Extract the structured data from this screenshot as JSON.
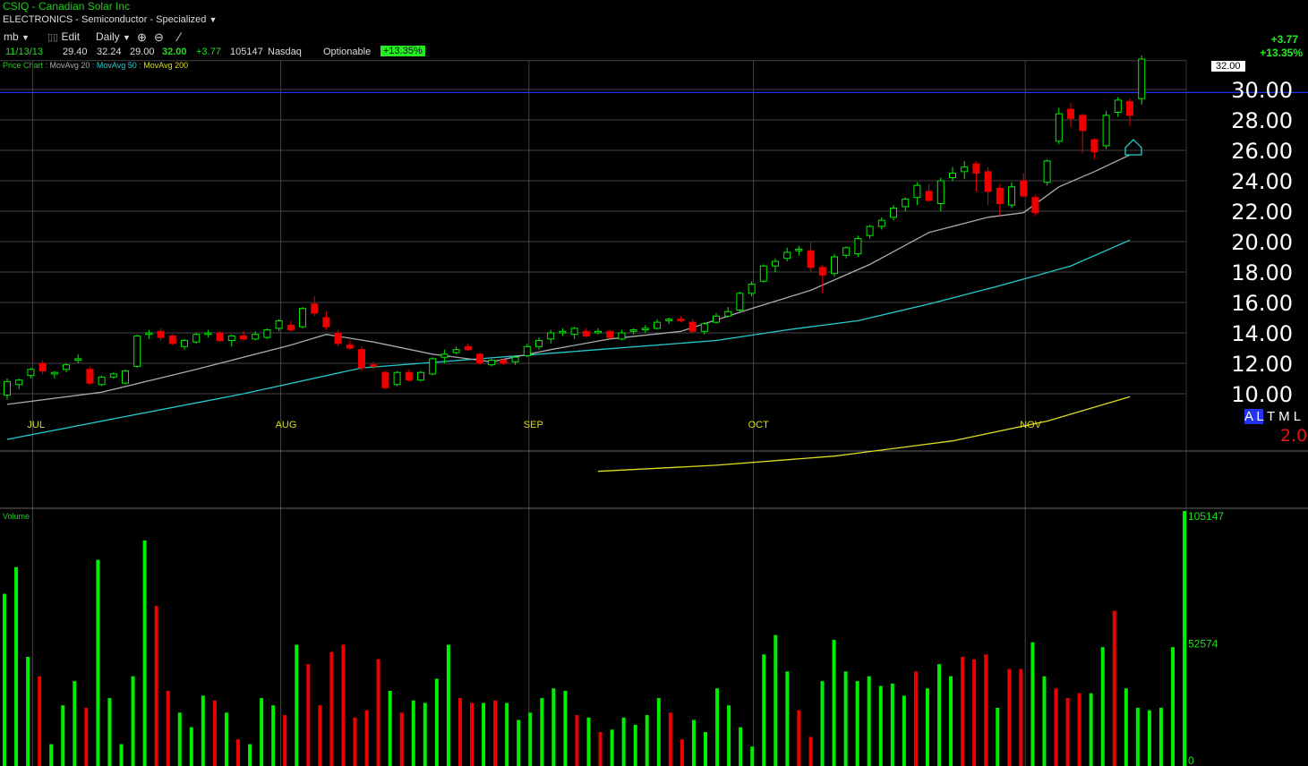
{
  "header": {
    "symbol_title": "CSIQ - Canadian Solar Inc",
    "sector": "ELECTRONICS - Semiconductor - Specialized",
    "toolbar": {
      "list_label": "mb",
      "edit_label": "Edit",
      "period_label": "Daily"
    },
    "quote": {
      "date": "11/13/13",
      "open": "29.40",
      "high": "32.24",
      "low": "29.00",
      "close": "32.00",
      "change": "+3.77",
      "volume": "105147",
      "exchange": "Nasdaq",
      "optionable": "Optionable",
      "pct_change": "+13.35%"
    },
    "right_change": "+3.77",
    "right_pct": "+13.35%"
  },
  "legend": {
    "price_chart": "Price Chart",
    "ma20": "MovAvg 20",
    "ma50": "MovAvg 50",
    "ma200": "MovAvg 200"
  },
  "badges": {
    "last_price": "32.00",
    "al": "A L",
    "tml": "T M L",
    "rating": "2.0"
  },
  "colors": {
    "up": "#00ee00",
    "down": "#ee0000",
    "ma20": "#aaaaaa",
    "ma50": "#22cccc",
    "ma200": "#dddd22",
    "grid": "#444444",
    "hline": "#2233ee"
  },
  "chart_data": [
    {
      "type": "candlestick",
      "title": "CSIQ - Canadian Solar Inc",
      "ylim": [
        9,
        32.5
      ],
      "yticks": [
        "10.00",
        "12.00",
        "14.00",
        "16.00",
        "18.00",
        "20.00",
        "22.00",
        "24.00",
        "26.00",
        "28.00",
        "30.00"
      ],
      "ytick_values": [
        10,
        12,
        14,
        16,
        18,
        20,
        22,
        24,
        26,
        28,
        30
      ],
      "month_labels": [
        {
          "label": "JUL",
          "index": 2
        },
        {
          "label": "AUG",
          "index": 23
        },
        {
          "label": "SEP",
          "index": 44
        },
        {
          "label": "OCT",
          "index": 63
        },
        {
          "label": "NOV",
          "index": 86
        }
      ],
      "horizontal_line": 29.8,
      "candles": [
        [
          9.9,
          11.0,
          9.6,
          10.8
        ],
        [
          10.6,
          11.0,
          10.3,
          10.9
        ],
        [
          11.2,
          11.7,
          11.0,
          11.6
        ],
        [
          12.0,
          12.2,
          11.3,
          11.5
        ],
        [
          11.3,
          11.5,
          11.0,
          11.4
        ],
        [
          11.6,
          12.0,
          11.4,
          11.9
        ],
        [
          12.2,
          12.6,
          12.0,
          12.3
        ],
        [
          11.6,
          11.8,
          10.6,
          10.7
        ],
        [
          10.6,
          11.2,
          10.5,
          11.1
        ],
        [
          11.1,
          11.4,
          11.0,
          11.3
        ],
        [
          10.7,
          11.6,
          10.6,
          11.5
        ],
        [
          11.8,
          13.9,
          11.7,
          13.8
        ],
        [
          13.9,
          14.2,
          13.6,
          14.0
        ],
        [
          14.1,
          14.3,
          13.5,
          13.7
        ],
        [
          13.8,
          13.9,
          13.2,
          13.3
        ],
        [
          13.1,
          13.6,
          12.9,
          13.5
        ],
        [
          13.4,
          14.0,
          13.3,
          13.9
        ],
        [
          13.9,
          14.2,
          13.7,
          14.0
        ],
        [
          14.0,
          14.1,
          13.4,
          13.5
        ],
        [
          13.5,
          13.9,
          13.1,
          13.8
        ],
        [
          13.8,
          14.1,
          13.5,
          13.6
        ],
        [
          13.6,
          14.1,
          13.5,
          13.9
        ],
        [
          13.7,
          14.3,
          13.6,
          14.2
        ],
        [
          14.3,
          14.9,
          14.1,
          14.8
        ],
        [
          14.5,
          14.8,
          14.1,
          14.2
        ],
        [
          14.4,
          15.7,
          14.3,
          15.6
        ],
        [
          15.9,
          16.4,
          15.1,
          15.3
        ],
        [
          15.0,
          15.4,
          14.2,
          14.4
        ],
        [
          14.0,
          14.2,
          13.1,
          13.3
        ],
        [
          13.2,
          13.5,
          12.9,
          13.0
        ],
        [
          12.9,
          13.1,
          11.5,
          11.7
        ],
        [
          11.9,
          12.1,
          11.6,
          11.8
        ],
        [
          11.4,
          11.5,
          10.3,
          10.4
        ],
        [
          10.6,
          11.5,
          10.5,
          11.4
        ],
        [
          11.4,
          11.6,
          10.8,
          10.9
        ],
        [
          10.9,
          11.5,
          10.8,
          11.4
        ],
        [
          11.3,
          12.4,
          11.2,
          12.3
        ],
        [
          12.4,
          12.9,
          12.0,
          12.6
        ],
        [
          12.7,
          13.1,
          12.6,
          12.9
        ],
        [
          13.1,
          13.3,
          12.8,
          12.9
        ],
        [
          12.6,
          12.7,
          11.9,
          12.0
        ],
        [
          11.9,
          12.3,
          11.8,
          12.2
        ],
        [
          12.2,
          12.3,
          11.9,
          12.0
        ],
        [
          12.1,
          12.5,
          11.9,
          12.4
        ],
        [
          12.5,
          13.3,
          12.4,
          13.1
        ],
        [
          13.1,
          13.7,
          12.9,
          13.5
        ],
        [
          13.6,
          14.2,
          13.3,
          14.0
        ],
        [
          14.0,
          14.3,
          13.8,
          14.1
        ],
        [
          13.9,
          14.4,
          13.6,
          14.3
        ],
        [
          14.1,
          14.3,
          13.7,
          13.8
        ],
        [
          14.0,
          14.3,
          13.9,
          14.1
        ],
        [
          14.1,
          14.2,
          13.6,
          13.7
        ],
        [
          13.6,
          14.2,
          13.5,
          14.0
        ],
        [
          14.1,
          14.3,
          13.9,
          14.2
        ],
        [
          14.2,
          14.5,
          14.0,
          14.3
        ],
        [
          14.3,
          14.9,
          14.2,
          14.7
        ],
        [
          14.8,
          15.0,
          14.6,
          14.9
        ],
        [
          14.9,
          15.1,
          14.7,
          14.8
        ],
        [
          14.7,
          14.9,
          14.0,
          14.1
        ],
        [
          14.1,
          14.7,
          13.9,
          14.6
        ],
        [
          14.7,
          15.3,
          14.6,
          15.1
        ],
        [
          15.1,
          15.7,
          15.0,
          15.4
        ],
        [
          15.5,
          16.7,
          15.4,
          16.6
        ],
        [
          16.6,
          17.4,
          16.4,
          17.2
        ],
        [
          17.4,
          18.5,
          17.3,
          18.4
        ],
        [
          18.4,
          18.9,
          18.0,
          18.7
        ],
        [
          18.9,
          19.6,
          18.7,
          19.3
        ],
        [
          19.4,
          19.7,
          19.1,
          19.5
        ],
        [
          19.4,
          20.0,
          18.0,
          18.3
        ],
        [
          18.3,
          18.5,
          16.6,
          17.8
        ],
        [
          17.9,
          19.2,
          17.7,
          19.0
        ],
        [
          19.1,
          19.7,
          18.9,
          19.6
        ],
        [
          19.2,
          20.4,
          19.0,
          20.2
        ],
        [
          20.4,
          21.1,
          20.2,
          21.0
        ],
        [
          21.0,
          21.6,
          20.8,
          21.4
        ],
        [
          21.6,
          22.4,
          21.4,
          22.2
        ],
        [
          22.3,
          22.9,
          22.0,
          22.8
        ],
        [
          22.9,
          23.9,
          22.4,
          23.7
        ],
        [
          23.3,
          23.8,
          23.1,
          22.7
        ],
        [
          22.5,
          24.2,
          22.0,
          24.0
        ],
        [
          24.2,
          24.9,
          24.0,
          24.5
        ],
        [
          24.6,
          25.3,
          24.1,
          24.9
        ],
        [
          25.1,
          25.3,
          23.3,
          24.5
        ],
        [
          24.6,
          24.9,
          22.4,
          23.3
        ],
        [
          23.5,
          23.8,
          21.7,
          22.5
        ],
        [
          22.4,
          23.9,
          22.2,
          23.6
        ],
        [
          24.0,
          24.5,
          22.9,
          23.0
        ],
        [
          22.9,
          23.1,
          21.7,
          21.9
        ],
        [
          23.9,
          25.4,
          23.7,
          25.3
        ],
        [
          26.6,
          28.8,
          26.4,
          28.4
        ],
        [
          28.7,
          29.1,
          27.5,
          28.1
        ],
        [
          28.3,
          28.4,
          25.8,
          27.3
        ],
        [
          26.7,
          26.8,
          25.4,
          25.9
        ],
        [
          26.3,
          28.6,
          26.1,
          28.3
        ],
        [
          28.5,
          29.5,
          28.2,
          29.3
        ],
        [
          29.2,
          29.4,
          27.6,
          28.3
        ],
        [
          29.4,
          32.24,
          29.0,
          32.0
        ]
      ],
      "ma20": [
        [
          0,
          9.3
        ],
        [
          8,
          10.1
        ],
        [
          16,
          11.6
        ],
        [
          24,
          13.2
        ],
        [
          27,
          13.9
        ],
        [
          31,
          13.4
        ],
        [
          36,
          12.6
        ],
        [
          41,
          12.1
        ],
        [
          46,
          12.9
        ],
        [
          51,
          13.6
        ],
        [
          57,
          14.1
        ],
        [
          63,
          15.6
        ],
        [
          68,
          16.8
        ],
        [
          73,
          18.5
        ],
        [
          78,
          20.6
        ],
        [
          83,
          21.6
        ],
        [
          86,
          21.9
        ],
        [
          89,
          23.6
        ],
        [
          92,
          24.6
        ],
        [
          95,
          25.7
        ]
      ],
      "ma50": [
        [
          0,
          7.0
        ],
        [
          10,
          8.5
        ],
        [
          20,
          10.0
        ],
        [
          30,
          11.7
        ],
        [
          40,
          12.3
        ],
        [
          50,
          12.9
        ],
        [
          60,
          13.5
        ],
        [
          66,
          14.2
        ],
        [
          72,
          14.8
        ],
        [
          78,
          15.9
        ],
        [
          84,
          17.1
        ],
        [
          90,
          18.4
        ],
        [
          95,
          20.1
        ]
      ],
      "ma200": [
        [
          50,
          4.9
        ],
        [
          60,
          5.3
        ],
        [
          70,
          5.9
        ],
        [
          80,
          6.9
        ],
        [
          88,
          8.2
        ],
        [
          95,
          9.8
        ]
      ]
    },
    {
      "type": "bar",
      "title": "Volume",
      "yticks": [
        "105147",
        "52574",
        "0"
      ],
      "ytick_values": [
        105147,
        52574,
        0
      ],
      "ylim": [
        0,
        105147
      ],
      "volumes": [
        71000,
        82000,
        45000,
        37000,
        9000,
        25000,
        35000,
        24000,
        85000,
        28000,
        9000,
        37000,
        93000,
        66000,
        31000,
        22000,
        16000,
        29000,
        27000,
        22000,
        11000,
        9000,
        28000,
        25000,
        21000,
        50000,
        42000,
        25000,
        47000,
        50000,
        20000,
        23000,
        44000,
        31000,
        22000,
        27000,
        26000,
        36000,
        50000,
        28000,
        26000,
        26000,
        27000,
        26000,
        19000,
        22000,
        28000,
        32000,
        31000,
        21000,
        20000,
        14000,
        15000,
        20000,
        17000,
        21000,
        28000,
        22000,
        11000,
        19000,
        14000,
        32000,
        25000,
        16000,
        8000,
        46000,
        54000,
        39000,
        23000,
        12000,
        35000,
        52000,
        39000,
        35000,
        37000,
        33000,
        34000,
        29000,
        39000,
        32000,
        42000,
        37000,
        45000,
        44000,
        46000,
        24000,
        40000,
        40000,
        51000,
        37000,
        32000,
        28000,
        30000,
        30000,
        49000,
        64000,
        32000,
        24000,
        23000,
        24000,
        49000,
        105147
      ]
    }
  ]
}
